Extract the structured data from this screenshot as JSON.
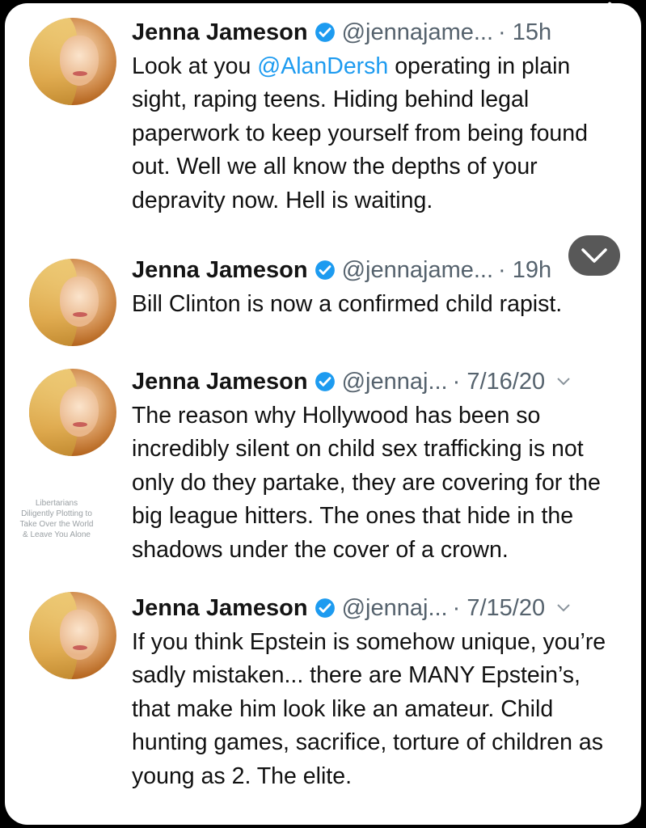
{
  "tweets": [
    {
      "name": "Jenna Jameson",
      "handle": "@jennajame...",
      "time": "· 15h",
      "mention": "@AlanDersh",
      "text_before": "Look at you ",
      "text_after": " operating in plain sight, raping teens. Hiding behind legal paperwork to keep yourself from being found out. Well we all know the depths of your depravity now. Hell is waiting."
    },
    {
      "name": "Jenna Jameson",
      "handle": "@jennajame...",
      "time": "· 19h",
      "text": "Bill Clinton is now a confirmed child rapist."
    },
    {
      "name": "Jenna Jameson",
      "handle": "@jennaj...",
      "time": "· 7/16/20",
      "text": "The reason why Hollywood has been so incredibly silent on child sex trafficking is not only do they partake, they are covering for the big league hitters. The ones that hide in the shadows under the cover of a crown."
    },
    {
      "name": "Jenna Jameson",
      "handle": "@jennaj...",
      "time": "· 7/15/20",
      "text": "If you think Epstein is somehow unique, you’re sadly mistaken... there are MANY Epstein’s, that make him look like an amateur. Child hunting games, sacrifice, torture of children as young as 2. The elite."
    }
  ],
  "watermark": {
    "line1": "Libertarians",
    "line2": "Diligently Plotting to",
    "line3": "Take Over the World",
    "line4": "& Leave You Alone"
  },
  "overlay_icons": [
    "pencil-icon",
    "sticker-icon",
    "camera-icon",
    "chevron-down-icon"
  ],
  "colors": {
    "accent": "#1d9bf0",
    "verified": "#1d9bf0",
    "meta": "#55626d"
  }
}
